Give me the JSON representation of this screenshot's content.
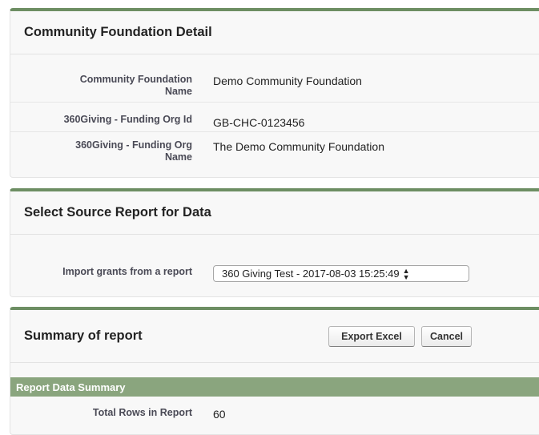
{
  "foundation_panel": {
    "title": "Community Foundation Detail",
    "rows": [
      {
        "label_line1": "Community Foundation",
        "label_line2": "Name",
        "value": "Demo Community Foundation"
      },
      {
        "label_line1": "360Giving - Funding Org Id",
        "label_line2": "",
        "value": "GB-CHC-0123456"
      },
      {
        "label_line1": "360Giving - Funding Org",
        "label_line2": "Name",
        "value": "The Demo Community Foundation"
      }
    ]
  },
  "source_panel": {
    "title": "Select Source Report for Data",
    "import_label": "Import grants from a report",
    "selected_report": "360 Giving Test - 2017-08-03 15:25:49"
  },
  "summary_panel": {
    "title": "Summary of report",
    "export_button": "Export Excel",
    "cancel_button": "Cancel",
    "section_title": "Report Data Summary",
    "total_rows_label": "Total Rows in Report",
    "total_rows_value": "60"
  },
  "colors": {
    "panel_accent": "#6d8e63",
    "section_bar": "#8aa57e"
  }
}
